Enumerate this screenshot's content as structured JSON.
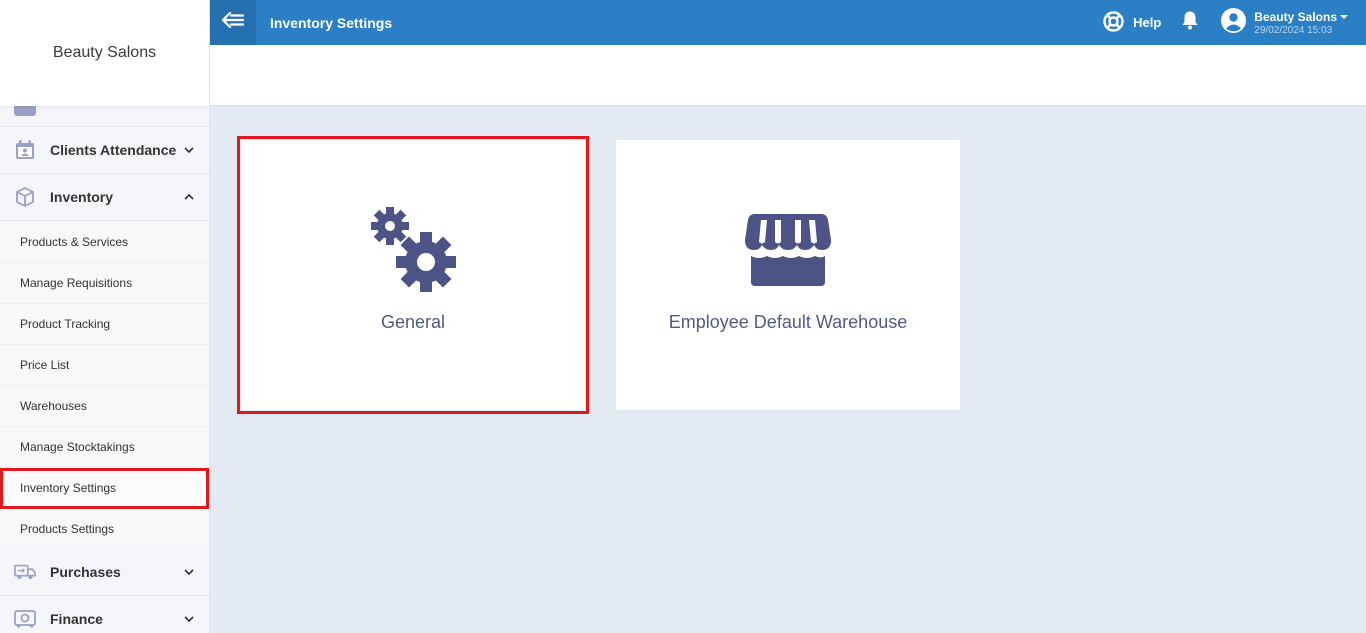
{
  "sidebar": {
    "brand": "Beauty Salons",
    "menu": [
      {
        "label": "Clients Attendance",
        "icon": "calendar-person-icon",
        "expanded": false
      },
      {
        "label": "Inventory",
        "icon": "box-icon",
        "expanded": true
      },
      {
        "label": "Purchases",
        "icon": "truck-icon",
        "expanded": false
      },
      {
        "label": "Finance",
        "icon": "safe-icon",
        "expanded": false
      }
    ],
    "inventory_items": [
      "Products & Services",
      "Manage Requisitions",
      "Product Tracking",
      "Price List",
      "Warehouses",
      "Manage Stocktakings",
      "Inventory Settings",
      "Products Settings"
    ],
    "active_item": "Inventory Settings"
  },
  "header": {
    "title": "Inventory Settings",
    "help_label": "Help",
    "user_name": "Beauty Salons",
    "datetime": "29/02/2024 15:03"
  },
  "cards": [
    {
      "label": "General",
      "icon": "gears-icon",
      "selected": true
    },
    {
      "label": "Employee Default Warehouse",
      "icon": "storefront-icon",
      "selected": false
    }
  ],
  "colors": {
    "header_bg": "#2b7fc4",
    "icon_color": "#4d5385",
    "highlight": "#e0191f",
    "content_bg": "#e4eaf2"
  }
}
